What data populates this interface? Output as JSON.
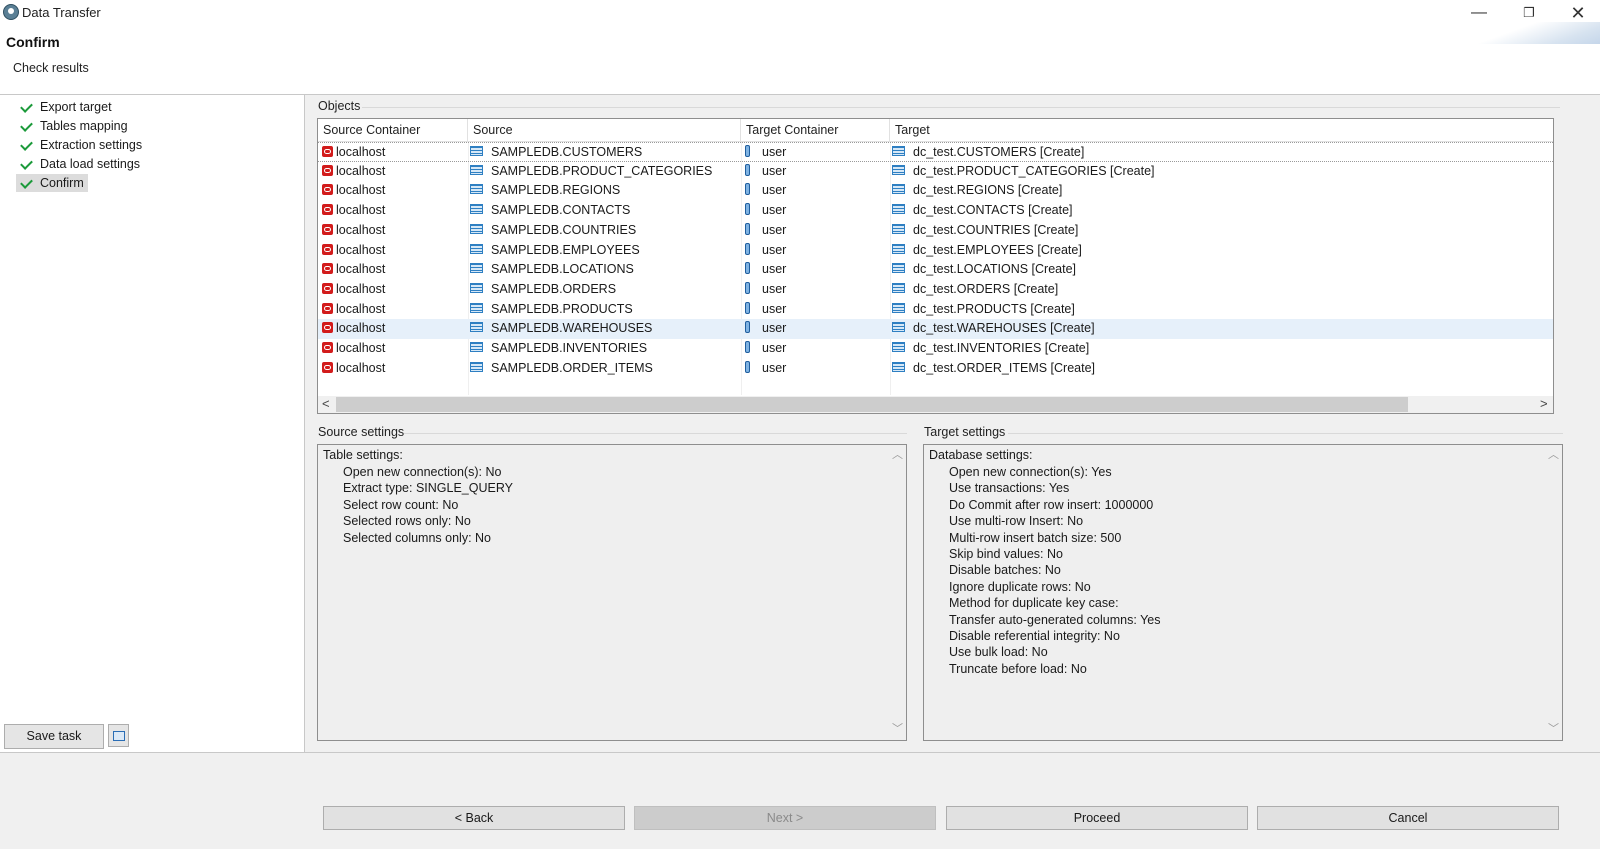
{
  "window": {
    "title": "Data Transfer",
    "minimize": "—",
    "maximize": "❐",
    "close": "✕"
  },
  "header": {
    "title": "Confirm",
    "subtitle": "Check results"
  },
  "nav": {
    "items": [
      {
        "label": "Export target"
      },
      {
        "label": "Tables mapping"
      },
      {
        "label": "Extraction settings"
      },
      {
        "label": "Data load settings"
      },
      {
        "label": "Confirm"
      }
    ],
    "selected": "Confirm"
  },
  "save_task_label": "Save task",
  "objects": {
    "label": "Objects",
    "columns": [
      "Source Container",
      "Source",
      "Target Container",
      "Target"
    ],
    "rows": [
      {
        "source_container": "localhost",
        "source": "SAMPLEDB.CUSTOMERS",
        "target_container": "user",
        "target": "dc_test.CUSTOMERS [Create]"
      },
      {
        "source_container": "localhost",
        "source": "SAMPLEDB.PRODUCT_CATEGORIES",
        "target_container": "user",
        "target": "dc_test.PRODUCT_CATEGORIES [Create]"
      },
      {
        "source_container": "localhost",
        "source": "SAMPLEDB.REGIONS",
        "target_container": "user",
        "target": "dc_test.REGIONS [Create]"
      },
      {
        "source_container": "localhost",
        "source": "SAMPLEDB.CONTACTS",
        "target_container": "user",
        "target": "dc_test.CONTACTS [Create]"
      },
      {
        "source_container": "localhost",
        "source": "SAMPLEDB.COUNTRIES",
        "target_container": "user",
        "target": "dc_test.COUNTRIES [Create]"
      },
      {
        "source_container": "localhost",
        "source": "SAMPLEDB.EMPLOYEES",
        "target_container": "user",
        "target": "dc_test.EMPLOYEES [Create]"
      },
      {
        "source_container": "localhost",
        "source": "SAMPLEDB.LOCATIONS",
        "target_container": "user",
        "target": "dc_test.LOCATIONS [Create]"
      },
      {
        "source_container": "localhost",
        "source": "SAMPLEDB.ORDERS",
        "target_container": "user",
        "target": "dc_test.ORDERS [Create]"
      },
      {
        "source_container": "localhost",
        "source": "SAMPLEDB.PRODUCTS",
        "target_container": "user",
        "target": "dc_test.PRODUCTS [Create]"
      },
      {
        "source_container": "localhost",
        "source": "SAMPLEDB.WAREHOUSES",
        "target_container": "user",
        "target": "dc_test.WAREHOUSES [Create]"
      },
      {
        "source_container": "localhost",
        "source": "SAMPLEDB.INVENTORIES",
        "target_container": "user",
        "target": "dc_test.INVENTORIES [Create]"
      },
      {
        "source_container": "localhost",
        "source": "SAMPLEDB.ORDER_ITEMS",
        "target_container": "user",
        "target": "dc_test.ORDER_ITEMS [Create]"
      }
    ],
    "selected_row": "SAMPLEDB.WAREHOUSES"
  },
  "source_settings": {
    "label": "Source settings",
    "heading": "Table settings:",
    "lines": [
      "Open new connection(s): No",
      "Extract type: SINGLE_QUERY",
      "Select row count: No",
      "Selected rows only: No",
      "Selected columns only: No"
    ]
  },
  "target_settings": {
    "label": "Target settings",
    "heading": "Database settings:",
    "lines": [
      "Open new connection(s): Yes",
      "Use transactions: Yes",
      "Do Commit after row insert: 1000000",
      "Use multi-row Insert: No",
      "Multi-row insert batch size: 500",
      "Skip bind values: No",
      "Disable batches: No",
      "Ignore duplicate rows: No",
      "Method for duplicate key case:",
      "Transfer auto-generated columns: Yes",
      "Disable referential integrity: No",
      "Use bulk load: No",
      "Truncate before load: No"
    ]
  },
  "buttons": {
    "back": "< Back",
    "next": "Next >",
    "proceed": "Proceed",
    "cancel": "Cancel"
  },
  "icons": {
    "app": "dbeaver-icon",
    "nav_check": "check-icon",
    "source_container": "oracle-icon",
    "table": "table-icon",
    "schema": "schema-icon",
    "print": "print-icon"
  },
  "colors": {
    "check": "#1b9a3a",
    "oracle": "#d21b1b",
    "table_icon": "#2e7fc2",
    "selected_row": "#e6f0fa"
  }
}
